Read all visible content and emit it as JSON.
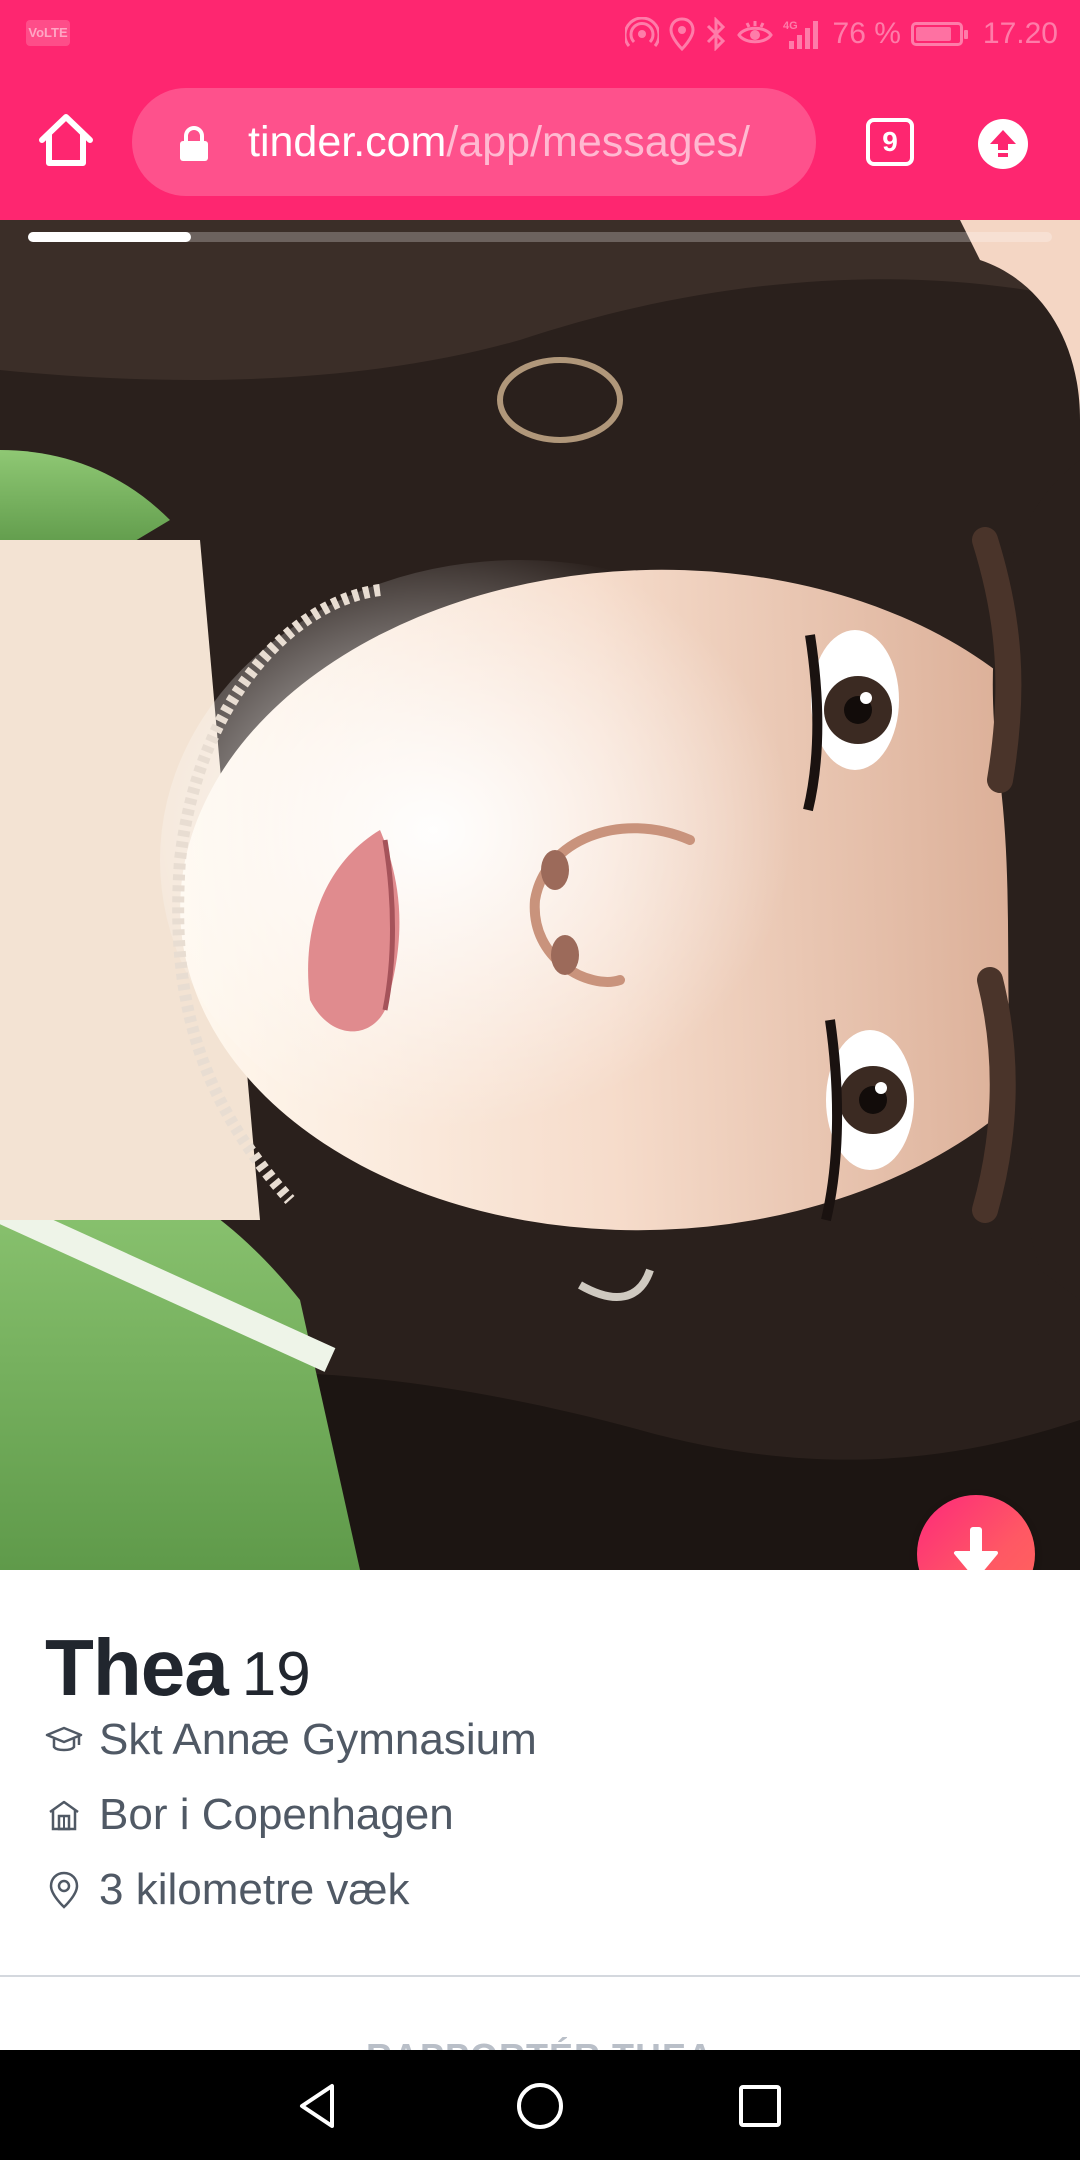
{
  "status_bar": {
    "network_badge": "VoLTE",
    "network_type": "4G",
    "battery_text": "76 %",
    "battery_level": 0.76,
    "time": "17.20"
  },
  "browser": {
    "url_domain": "tinder.com",
    "url_path": "/app/messages/",
    "tab_count": "9"
  },
  "profile": {
    "photo_index": 1,
    "photo_count": 6,
    "name": "Thea",
    "age": "19",
    "school": "Skt Annæ Gymnasium",
    "residence": "Bor i Copenhagen",
    "distance": "3 kilometre væk",
    "report_label": "RAPPORTÉR THEA"
  },
  "colors": {
    "brand": "#FE2670",
    "accent_gradient_start": "#FD297B",
    "accent_gradient_end": "#FF655B",
    "text_primary": "#21262E",
    "text_secondary": "#505965"
  },
  "icons": {
    "home": "home-icon",
    "lock": "lock-icon",
    "tabs": "tabs-icon",
    "upload": "upload-icon",
    "collapse": "arrow-down-icon",
    "school": "graduation-cap-icon",
    "residence": "house-icon",
    "distance": "location-pin-icon",
    "nav_back": "triangle-back-icon",
    "nav_home": "circle-home-icon",
    "nav_recent": "square-recent-icon"
  }
}
